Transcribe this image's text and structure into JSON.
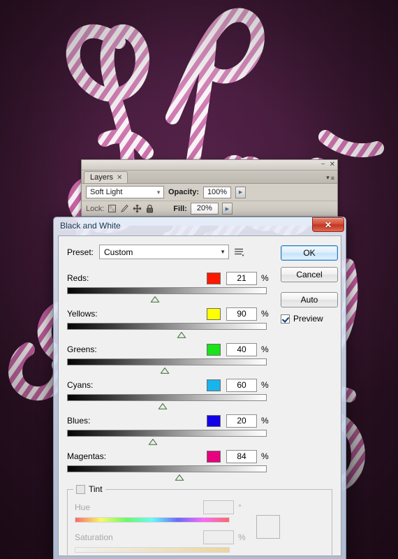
{
  "background": {
    "artwork_alt": "candy-cane rope lettering artwork",
    "base_color": "#3a1830",
    "candy_stripe_color": "#c2549c",
    "candy_base_color": "#f4eef2"
  },
  "layers_panel": {
    "tab_label": "Layers",
    "tab_close_glyph": "✕",
    "minimize_glyph": "−",
    "close_glyph": "✕",
    "menu_glyph": "≡",
    "blend_mode": "Soft Light",
    "blend_caret": "▼",
    "opacity_label": "Opacity:",
    "opacity_value": "100%",
    "opacity_spin": "▶",
    "fill_label": "Fill:",
    "fill_value": "20%",
    "fill_spin": "▶",
    "lock_label": "Lock:"
  },
  "dialog": {
    "title": "Black and White",
    "close_glyph": "✕",
    "preset": {
      "label": "Preset:",
      "value": "Custom",
      "caret": "▼",
      "menu_icon": "preset-options-icon"
    },
    "sliders": [
      {
        "name": "Reds:",
        "value": "21",
        "unit": "%",
        "color": "#ff1800",
        "thumb_pct": 43
      },
      {
        "name": "Yellows:",
        "value": "90",
        "unit": "%",
        "color": "#ffff00",
        "thumb_pct": 56
      },
      {
        "name": "Greens:",
        "value": "40",
        "unit": "%",
        "color": "#19e319",
        "thumb_pct": 48
      },
      {
        "name": "Cyans:",
        "value": "60",
        "unit": "%",
        "color": "#1ab4ec",
        "thumb_pct": 47
      },
      {
        "name": "Blues:",
        "value": "20",
        "unit": "%",
        "color": "#1200e6",
        "thumb_pct": 42
      },
      {
        "name": "Magentas:",
        "value": "84",
        "unit": "%",
        "color": "#e6007e",
        "thumb_pct": 55
      }
    ],
    "buttons": {
      "ok": "OK",
      "cancel": "Cancel",
      "auto": "Auto"
    },
    "preview": {
      "label": "Preview",
      "checked": true
    },
    "tint": {
      "legend": "Tint",
      "enabled": false,
      "hue_label": "Hue",
      "hue_value": "",
      "hue_unit": "°",
      "saturation_label": "Saturation",
      "saturation_value": "",
      "saturation_unit": "%"
    }
  }
}
